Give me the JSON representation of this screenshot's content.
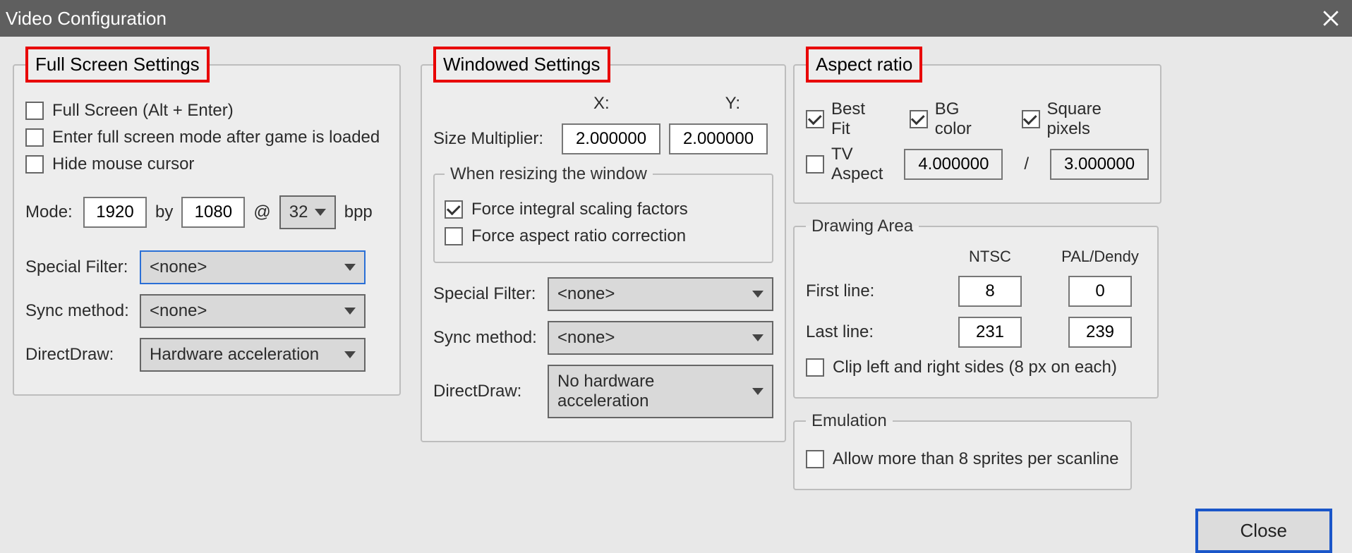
{
  "title": "Video Configuration",
  "close_label": "Close",
  "fullscreen": {
    "legend": "Full Screen Settings",
    "fullscreen_cb": "Full Screen (Alt + Enter)",
    "enter_after_load_cb": "Enter full screen mode after game is loaded",
    "hide_mouse_cb": "Hide mouse cursor",
    "mode_label": "Mode:",
    "mode_w": "1920",
    "mode_by": "by",
    "mode_h": "1080",
    "mode_at": "@",
    "bpp": "32",
    "bpp_suffix": "bpp",
    "special_filter_label": "Special Filter:",
    "special_filter_value": "<none>",
    "sync_method_label": "Sync method:",
    "sync_method_value": "<none>",
    "directdraw_label": "DirectDraw:",
    "directdraw_value": "Hardware acceleration"
  },
  "windowed": {
    "legend": "Windowed Settings",
    "x_label": "X:",
    "y_label": "Y:",
    "size_multiplier_label": "Size Multiplier:",
    "size_x": "2.000000",
    "size_y": "2.000000",
    "resizing_legend": "When resizing the window",
    "force_integral_cb": "Force integral scaling factors",
    "force_integral_checked": true,
    "force_aspect_cb": "Force aspect ratio correction",
    "special_filter_label": "Special Filter:",
    "special_filter_value": "<none>",
    "sync_method_label": "Sync method:",
    "sync_method_value": "<none>",
    "directdraw_label": "DirectDraw:",
    "directdraw_value": "No hardware acceleration"
  },
  "aspect": {
    "legend": "Aspect ratio",
    "best_fit_cb": "Best Fit",
    "best_fit_checked": true,
    "bg_color_cb": "BG color",
    "bg_color_checked": true,
    "square_pixels_cb": "Square pixels",
    "square_pixels_checked": true,
    "tv_aspect_cb": "TV Aspect",
    "tv_aspect_a": "4.000000",
    "tv_slash": "/",
    "tv_aspect_b": "3.000000"
  },
  "drawing": {
    "legend": "Drawing Area",
    "ntsc_label": "NTSC",
    "pal_label": "PAL/Dendy",
    "first_line_label": "First line:",
    "first_ntsc": "8",
    "first_pal": "0",
    "last_line_label": "Last line:",
    "last_ntsc": "231",
    "last_pal": "239",
    "clip_cb": "Clip left and right sides (8 px on each)"
  },
  "emulation": {
    "legend": "Emulation",
    "sprites_cb": "Allow more than 8 sprites per scanline"
  }
}
